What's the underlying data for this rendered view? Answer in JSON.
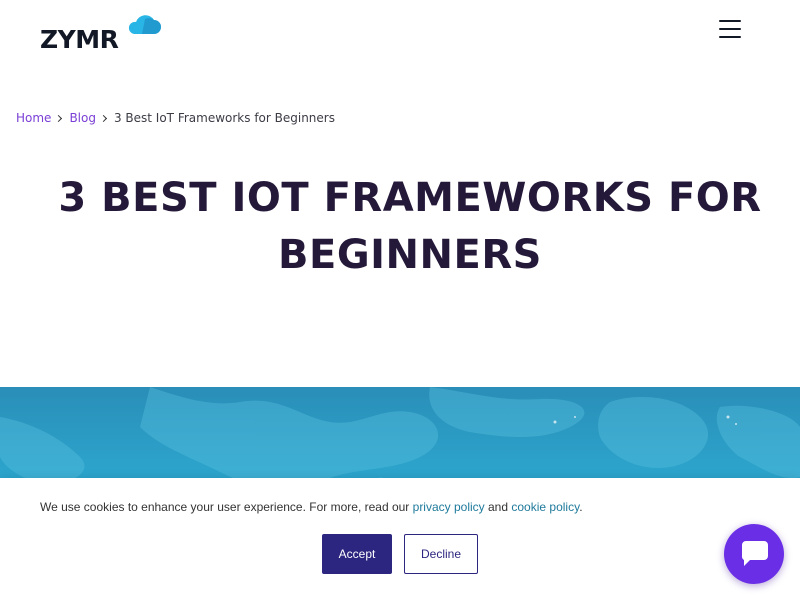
{
  "header": {
    "logo_text": "ZYMR",
    "logo_icon": "cloud-icon",
    "menu_icon": "hamburger-menu-icon"
  },
  "breadcrumb": {
    "items": [
      {
        "label": "Home"
      },
      {
        "label": "Blog"
      },
      {
        "label": "3 Best IoT Frameworks for Beginners"
      }
    ]
  },
  "main": {
    "title_line1": "3 BEST IOT FRAMEWORKS FOR",
    "title_line2": "BEGINNERS"
  },
  "cookie_banner": {
    "text_before": "We use cookies to enhance your user experience. For more, read our ",
    "privacy_link": "privacy policy",
    "text_middle": " and ",
    "cookie_link": "cookie policy",
    "text_after": ".",
    "accept_label": "Accept",
    "decline_label": "Decline"
  },
  "chat": {
    "icon": "chat-bubble-icon"
  },
  "colors": {
    "brand_purple": "#6a2ee6",
    "accept_bg": "#2d2680",
    "link_purple": "#7a3fd6",
    "title_color": "#25193a",
    "hero_blue": "#2ca4cc"
  }
}
